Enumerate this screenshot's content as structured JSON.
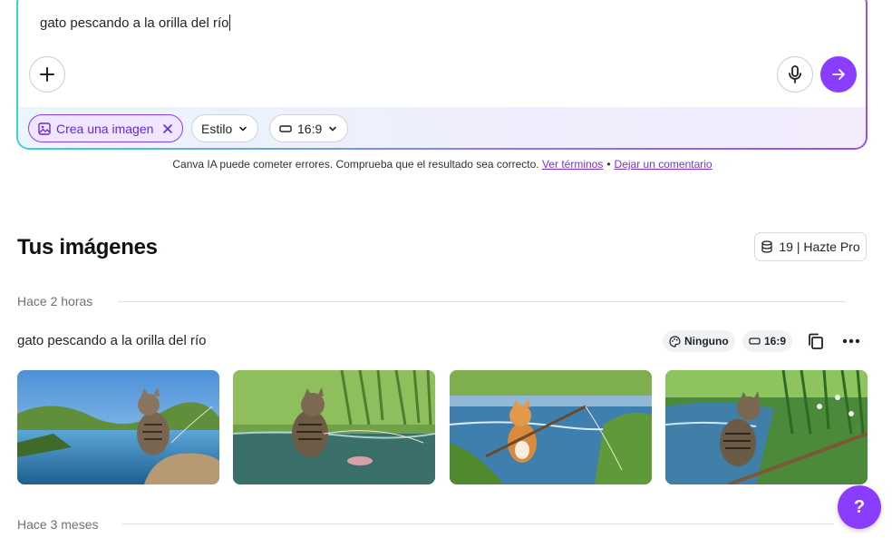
{
  "prompt": {
    "text": "gato pescando a la orilla del río",
    "chips": {
      "create_image": "Crea una imagen",
      "style": "Estilo",
      "ratio": "16:9"
    }
  },
  "disclaimer": {
    "text": "Canva IA puede cometer errores. Comprueba que el resultado sea correcto.",
    "terms_link": "Ver términos",
    "separator": "•",
    "feedback_link": "Dejar un comentario"
  },
  "gallery": {
    "title": "Tus imágenes",
    "credits_label": "19 | Hazte Pro",
    "groups": [
      {
        "time": "Hace 2 horas",
        "prompt": "gato pescando a la orilla del río",
        "style_tag": "Ninguno",
        "ratio_tag": "16:9"
      },
      {
        "time": "Hace 3 meses"
      }
    ]
  },
  "help": {
    "label": "?"
  },
  "colors": {
    "accent": "#8b3dff",
    "link": "#7b2fe0",
    "chip_bg": "#efe6ff"
  },
  "icons": {
    "add": "plus-icon",
    "mic": "microphone-icon",
    "send": "arrow-right-icon",
    "image": "image-icon",
    "remove": "close-icon",
    "chevron": "chevron-down-icon",
    "ratio": "rectangle-icon",
    "credits": "database-icon",
    "style": "palette-icon",
    "copy": "copy-icon",
    "more": "more-horizontal-icon"
  }
}
